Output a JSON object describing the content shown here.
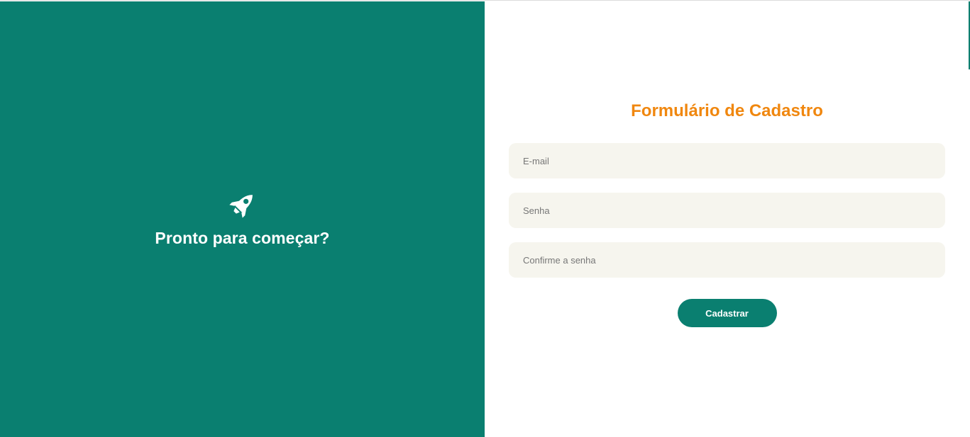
{
  "left_panel": {
    "icon": "rocket-icon",
    "headline": "Pronto para começar?"
  },
  "form": {
    "title": "Formulário de Cadastro",
    "email_placeholder": "E-mail",
    "password_placeholder": "Senha",
    "confirm_password_placeholder": "Confirme a senha",
    "submit_label": "Cadastrar"
  },
  "colors": {
    "primary_green": "#0a7f70",
    "accent_orange": "#f0870f",
    "input_background": "#f6f5ee"
  }
}
